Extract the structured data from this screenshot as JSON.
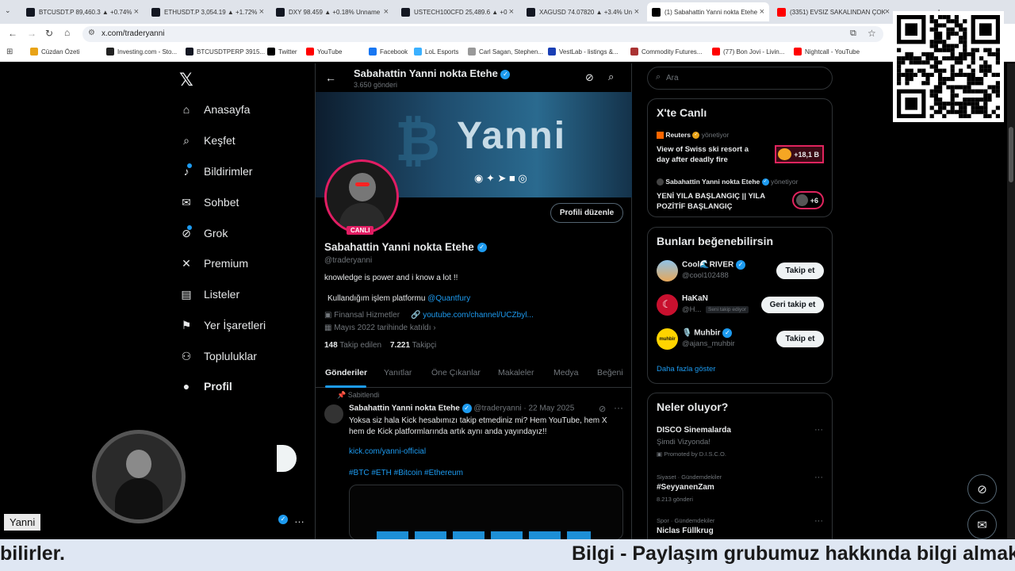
{
  "browser": {
    "tabs": [
      {
        "label": "BTCUSDT.P 89,460.3 ▲ +0.74%",
        "icon_color": "#131722"
      },
      {
        "label": "ETHUSDT.P 3,054.19 ▲ +1.72%",
        "icon_color": "#131722"
      },
      {
        "label": "DXY 98.459 ▲ +0.18% Unname",
        "icon_color": "#131722"
      },
      {
        "label": "USTECH100CFD 25,489.6 ▲ +0",
        "icon_color": "#131722"
      },
      {
        "label": "XAGUSD 74.07820 ▲ +3.4% Un",
        "icon_color": "#131722"
      },
      {
        "label": "(1) Sabahattin Yanni nokta Etehe",
        "icon_color": "#000000"
      },
      {
        "label": "(3351) EVSIZ SAKALINDAN ÇOK",
        "icon_color": "#ff0000"
      }
    ],
    "url": "x.com/traderyanni",
    "bookmarks": [
      {
        "label": "Cüzdan Özeti",
        "icon_color": "#e8a317"
      },
      {
        "label": "Investing.com - Sto...",
        "icon_color": "#222222"
      },
      {
        "label": "BTCUSDTPERP 3915...",
        "icon_color": "#131722"
      },
      {
        "label": "Twitter",
        "icon_color": "#000000"
      },
      {
        "label": "YouTube",
        "icon_color": "#ff0000"
      },
      {
        "label": "Facebook",
        "icon_color": "#1877f2"
      },
      {
        "label": "LoL Esports",
        "icon_color": "#3ab0ff"
      },
      {
        "label": "Carl Sagan, Stephen...",
        "icon_color": "#999999"
      },
      {
        "label": "VestLab - listings &...",
        "icon_color": "#1a3fb5"
      },
      {
        "label": "Commodity Futures...",
        "icon_color": "#a33"
      },
      {
        "label": "(77) Bon Jovi - Livin...",
        "icon_color": "#ff0000"
      },
      {
        "label": "Nightcall - YouTube",
        "icon_color": "#ff0000"
      }
    ]
  },
  "nav": {
    "items": [
      {
        "label": "Anasayfa",
        "icon": "home-icon",
        "glyph": "⌂"
      },
      {
        "label": "Keşfet",
        "icon": "search-icon",
        "glyph": "⌕"
      },
      {
        "label": "Bildirimler",
        "icon": "bell-icon",
        "glyph": "♪"
      },
      {
        "label": "Sohbet",
        "icon": "mail-icon",
        "glyph": "✉"
      },
      {
        "label": "Grok",
        "icon": "grok-icon",
        "glyph": "⊘"
      },
      {
        "label": "Premium",
        "icon": "x-icon",
        "glyph": "✕"
      },
      {
        "label": "Listeler",
        "icon": "list-icon",
        "glyph": "▤"
      },
      {
        "label": "Yer İşaretleri",
        "icon": "bookmark-icon",
        "glyph": "⚑"
      },
      {
        "label": "Topluluklar",
        "icon": "people-icon",
        "glyph": "⚇"
      },
      {
        "label": "Profil",
        "icon": "person-icon",
        "glyph": "●"
      }
    ]
  },
  "profile": {
    "header_name": "Sabahattin Yanni nokta Etehe",
    "post_count": "3.650 gönderi",
    "banner_text": "Yanni",
    "live_badge": "CANLI",
    "edit_button": "Profili düzenle",
    "name": "Sabahattin Yanni nokta Etehe",
    "handle": "@traderyanni",
    "bio": "knowledge is power and i know a lot !!",
    "platform_text": "Kullandığım işlem platformu",
    "platform_link": "@Quantfury",
    "category": "Finansal Hizmetler",
    "website": "youtube.com/channel/UCZbyl...",
    "joined": "Mayıs 2022 tarihinde katıldı",
    "following_count": "148",
    "following_label": "Takip edilen",
    "followers_count": "7.221",
    "followers_label": "Takipçi",
    "tabs": [
      "Gönderiler",
      "Yanıtlar",
      "Öne Çıkanlar",
      "Makaleler",
      "Medya",
      "Beğeni"
    ]
  },
  "pinned_post": {
    "pinned_label": "Sabitlendi",
    "author": "Sabahattin Yanni nokta Etehe",
    "handle_date": "@traderyanni · 22 May 2025",
    "text": "Yoksa siz hala Kick hesabımızı takip etmediniz mi? Hem YouTube, hem X hem de Kick platformlarında artık aynı anda yayındayız!!",
    "link": "kick.com/yanni-official",
    "hashtags": "#BTC #ETH #Bitcoin #Ethereum"
  },
  "search": {
    "placeholder": "Ara"
  },
  "live": {
    "title": "X'te Canlı",
    "items": [
      {
        "host": "Reuters",
        "status": "yönetiyor",
        "title": "View of Swiss ski resort a day after deadly fire",
        "count": "+18,1 B"
      },
      {
        "host": "Sabahattin Yanni nokta Etehe",
        "status": "yönetiyor",
        "title": "YENİ YILA BAŞLANGIÇ || YILA POZİTİF BAŞLANGIÇ",
        "count": "+6"
      }
    ]
  },
  "suggest": {
    "title": "Bunları beğenebilirsin",
    "users": [
      {
        "name": "Cool🌊RIVER",
        "handle": "@cool102488",
        "button": "Takip et",
        "tag": ""
      },
      {
        "name": "HaKaN",
        "handle": "@H...",
        "button": "Geri takip et",
        "tag": "Seni takip ediyor"
      },
      {
        "name": "🎙️ Muhbir",
        "handle": "@ajans_muhbir",
        "button": "Takip et",
        "tag": ""
      }
    ],
    "more": "Daha fazla göster"
  },
  "trends": {
    "title": "Neler oluyor?",
    "items": [
      {
        "context": "",
        "name": "DISCO Sinemalarda",
        "meta": "Şimdi Vizyonda!",
        "promo": "Promoted by D.I.S.C.O."
      },
      {
        "context": "Siyaset · Gündemdekiler",
        "name": "#SeyyanenZam",
        "meta": "8.213 gönderi",
        "promo": ""
      },
      {
        "context": "Spor · Gündemdekiler",
        "name": "Niclas Füllkrug",
        "meta": "",
        "promo": ""
      }
    ]
  },
  "overlay": {
    "streamer_label": "Yanni"
  },
  "ticker": {
    "left_text": "bilirler.",
    "right_text": "Bilgi - Paylaşım grubumuz hakkında bilgi almak"
  }
}
